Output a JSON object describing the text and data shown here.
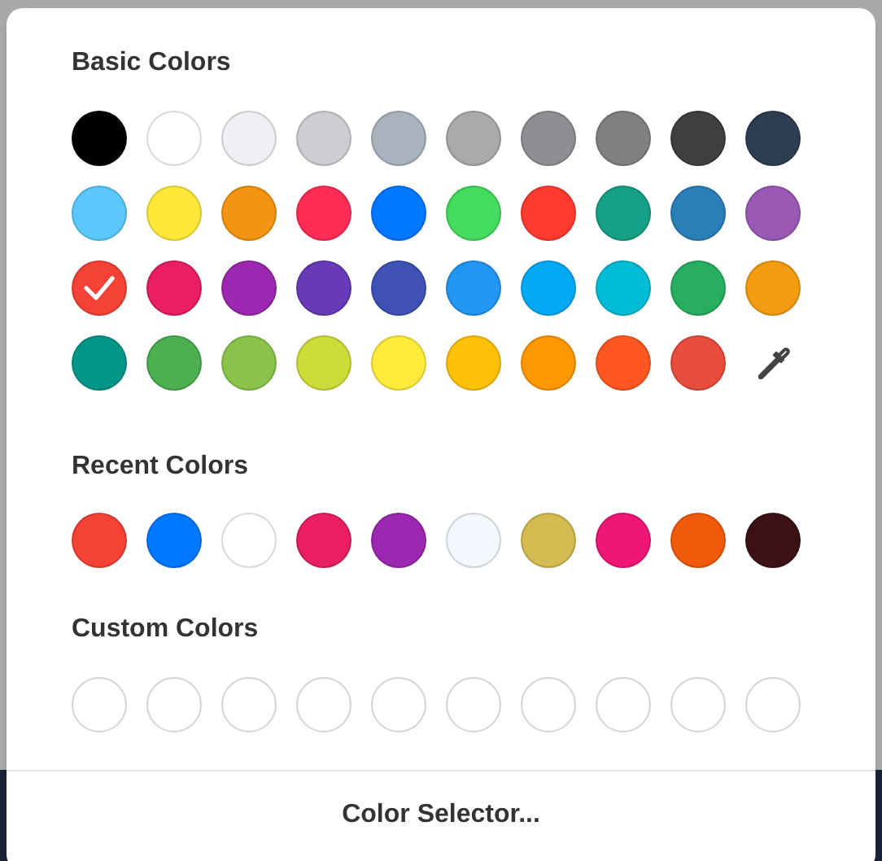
{
  "basic_colors": {
    "title": "Basic Colors",
    "items": [
      {
        "kind": "swatch",
        "color": "#000000",
        "selected": false
      },
      {
        "kind": "swatch",
        "color": "#ffffff",
        "selected": false
      },
      {
        "kind": "swatch",
        "color": "#efeff4",
        "selected": false
      },
      {
        "kind": "swatch",
        "color": "#ceced2",
        "selected": false
      },
      {
        "kind": "swatch",
        "color": "#a9b3bd",
        "selected": false
      },
      {
        "kind": "swatch",
        "color": "#aaaaaa",
        "selected": false
      },
      {
        "kind": "swatch",
        "color": "#8e8e93",
        "selected": false
      },
      {
        "kind": "swatch",
        "color": "#808080",
        "selected": false
      },
      {
        "kind": "swatch",
        "color": "#3f3f3f",
        "selected": false
      },
      {
        "kind": "swatch",
        "color": "#2c3e50",
        "selected": false
      },
      {
        "kind": "swatch",
        "color": "#5ac8fa",
        "selected": false
      },
      {
        "kind": "swatch",
        "color": "#ffe83a",
        "selected": false
      },
      {
        "kind": "swatch",
        "color": "#f39412",
        "selected": false
      },
      {
        "kind": "swatch",
        "color": "#ff2d55",
        "selected": false
      },
      {
        "kind": "swatch",
        "color": "#0077ff",
        "selected": false
      },
      {
        "kind": "swatch",
        "color": "#44db5e",
        "selected": false
      },
      {
        "kind": "swatch",
        "color": "#ff3b30",
        "selected": false
      },
      {
        "kind": "swatch",
        "color": "#16a085",
        "selected": false
      },
      {
        "kind": "swatch",
        "color": "#2980b9",
        "selected": false
      },
      {
        "kind": "swatch",
        "color": "#9b59b6",
        "selected": false
      },
      {
        "kind": "swatch",
        "color": "#f44336",
        "selected": true
      },
      {
        "kind": "swatch",
        "color": "#e91e63",
        "selected": false
      },
      {
        "kind": "swatch",
        "color": "#9c27b0",
        "selected": false
      },
      {
        "kind": "swatch",
        "color": "#673ab7",
        "selected": false
      },
      {
        "kind": "swatch",
        "color": "#3f51b5",
        "selected": false
      },
      {
        "kind": "swatch",
        "color": "#2196f3",
        "selected": false
      },
      {
        "kind": "swatch",
        "color": "#03a9f4",
        "selected": false
      },
      {
        "kind": "swatch",
        "color": "#00bcd4",
        "selected": false
      },
      {
        "kind": "swatch",
        "color": "#27ae60",
        "selected": false
      },
      {
        "kind": "swatch",
        "color": "#f39c12",
        "selected": false
      },
      {
        "kind": "swatch",
        "color": "#009688",
        "selected": false
      },
      {
        "kind": "swatch",
        "color": "#4caf50",
        "selected": false
      },
      {
        "kind": "swatch",
        "color": "#8bc34a",
        "selected": false
      },
      {
        "kind": "swatch",
        "color": "#cddc39",
        "selected": false
      },
      {
        "kind": "swatch",
        "color": "#ffeb3b",
        "selected": false
      },
      {
        "kind": "swatch",
        "color": "#ffc107",
        "selected": false
      },
      {
        "kind": "swatch",
        "color": "#ff9800",
        "selected": false
      },
      {
        "kind": "swatch",
        "color": "#ff5722",
        "selected": false
      },
      {
        "kind": "swatch",
        "color": "#e74c3c",
        "selected": false
      },
      {
        "kind": "eyedropper"
      }
    ]
  },
  "recent_colors": {
    "title": "Recent Colors",
    "items": [
      {
        "color": "#f44336"
      },
      {
        "color": "#0077ff"
      },
      {
        "color": "#ffffff"
      },
      {
        "color": "#e91e63"
      },
      {
        "color": "#9c27b0"
      },
      {
        "color": "#f2f8fd"
      },
      {
        "color": "#d4bb52"
      },
      {
        "color": "#ef1675"
      },
      {
        "color": "#f05a0a"
      },
      {
        "color": "#3b1113"
      }
    ]
  },
  "custom_colors": {
    "title": "Custom Colors",
    "slots": [
      {
        "kind": "empty"
      },
      {
        "kind": "empty"
      },
      {
        "kind": "empty"
      },
      {
        "kind": "empty"
      },
      {
        "kind": "empty"
      },
      {
        "kind": "empty"
      },
      {
        "kind": "empty"
      },
      {
        "kind": "empty"
      },
      {
        "kind": "empty"
      },
      {
        "kind": "empty"
      }
    ]
  },
  "footer_button": "Color Selector..."
}
